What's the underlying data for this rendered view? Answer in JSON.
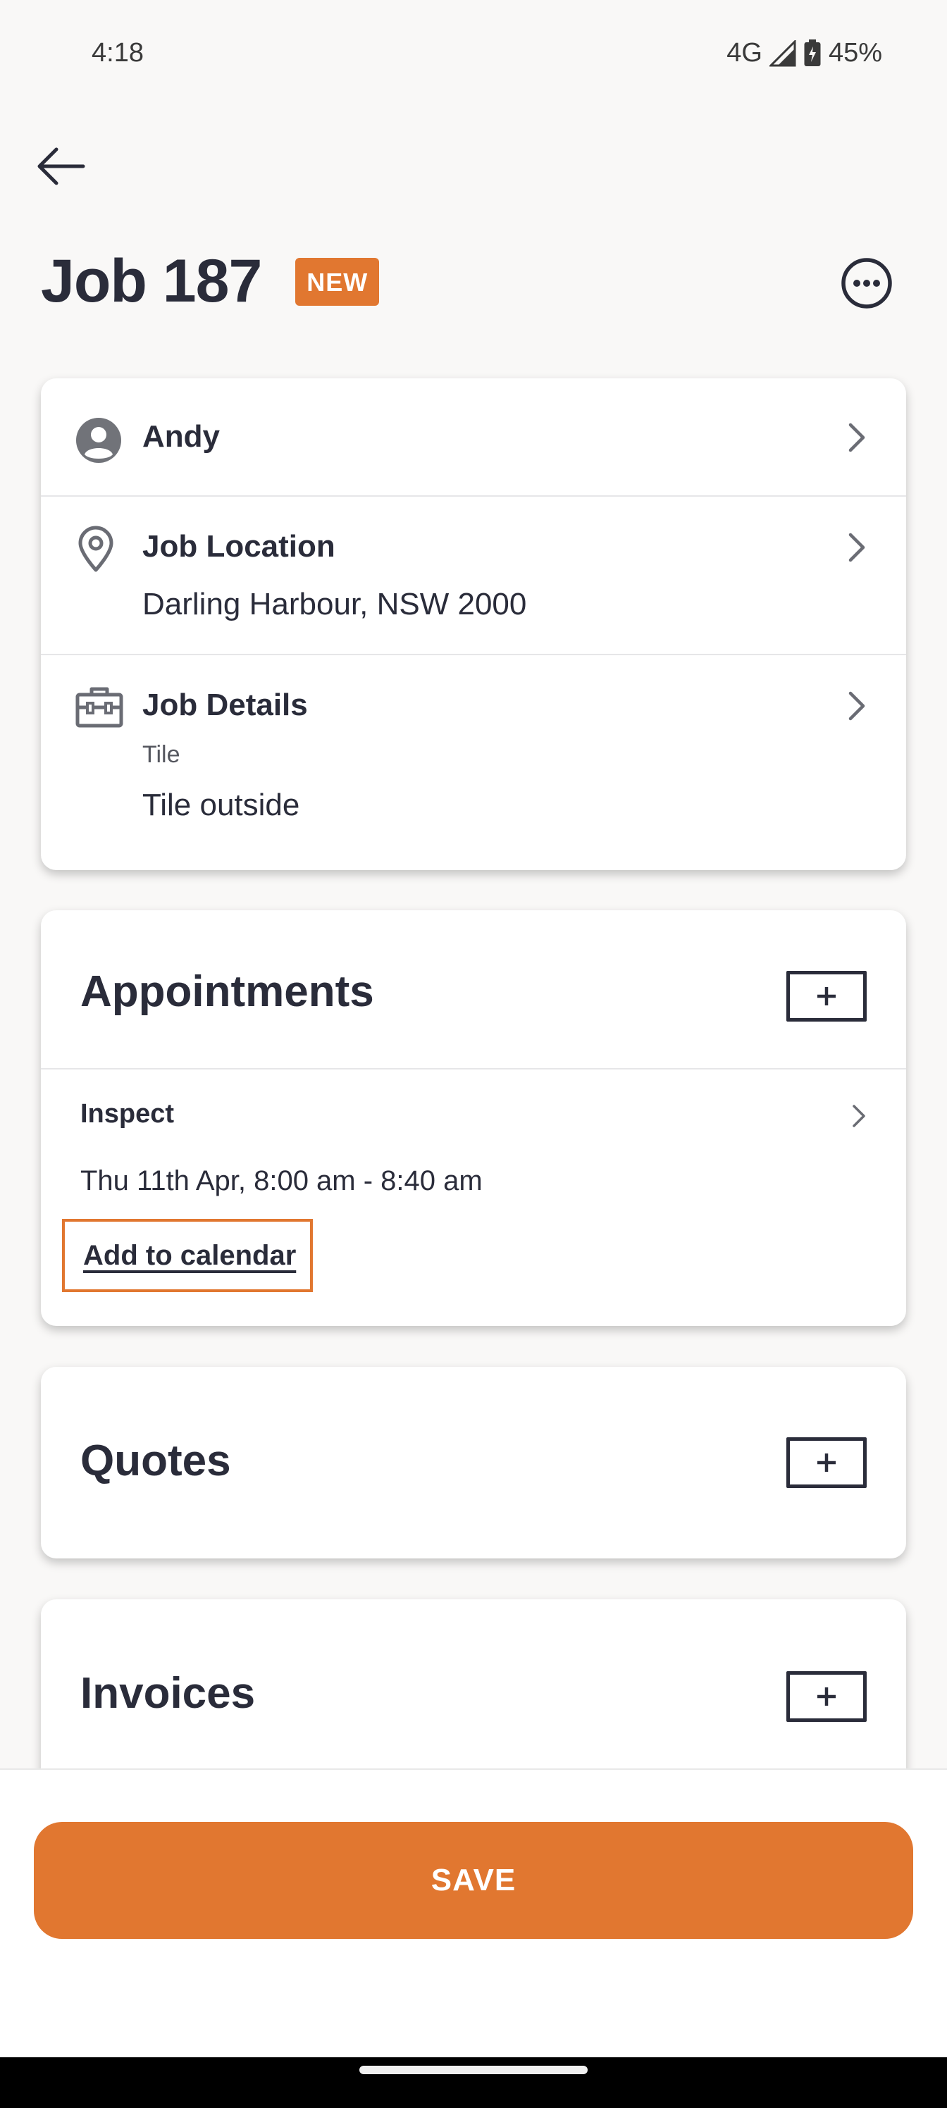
{
  "status_bar": {
    "time": "4:18",
    "network": "4G",
    "battery": "45%"
  },
  "header": {
    "title": "Job 187",
    "badge": "NEW"
  },
  "details_card": {
    "customer": "Andy",
    "location_title": "Job Location",
    "location_value": "Darling Harbour, NSW 2000",
    "job_details_title": "Job Details",
    "job_category": "Tile",
    "job_description": "Tile outside"
  },
  "appointments": {
    "title": "Appointments",
    "items": [
      {
        "type": "Inspect",
        "time": "Thu 11th Apr, 8:00 am - 8:40 am",
        "calendar_link": "Add to calendar"
      }
    ]
  },
  "quotes": {
    "title": "Quotes"
  },
  "invoices": {
    "title": "Invoices"
  },
  "footer": {
    "save_label": "SAVE"
  },
  "colors": {
    "accent": "#e17730",
    "text": "#2a2c3a",
    "background": "#f9f8f7"
  }
}
